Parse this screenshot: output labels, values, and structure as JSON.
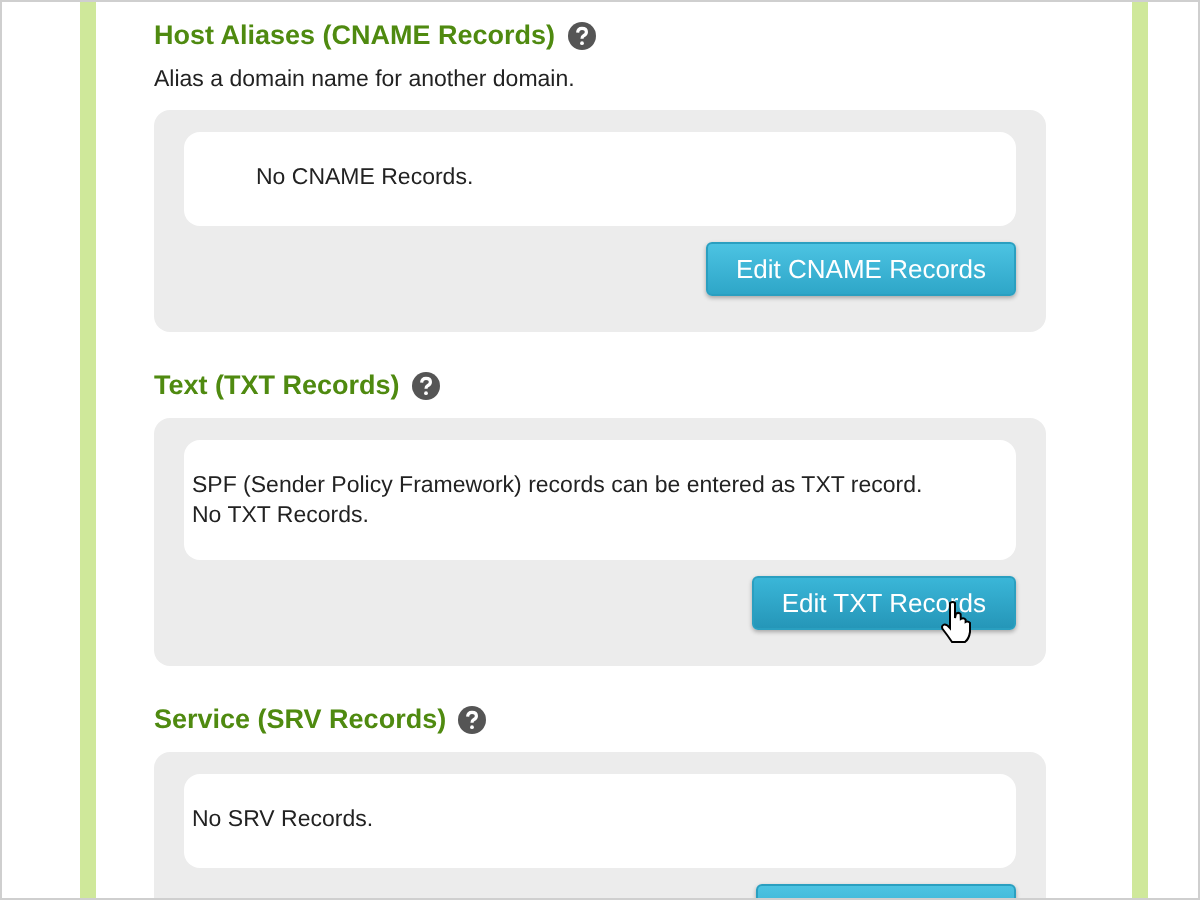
{
  "sections": [
    {
      "title": "Host Aliases (CNAME Records)",
      "description": "Alias a domain name for another domain.",
      "lines": [
        "No CNAME Records."
      ],
      "indent": true,
      "button": {
        "label": "Edit CNAME Records",
        "hovered": false
      }
    },
    {
      "title": "Text (TXT Records)",
      "lines": [
        "SPF (Sender Policy Framework) records can be entered as TXT record.",
        "No TXT Records."
      ],
      "indent": false,
      "button": {
        "label": "Edit TXT Records",
        "hovered": true
      }
    },
    {
      "title": "Service (SRV Records)",
      "lines": [
        "No SRV Records."
      ],
      "indent": false,
      "button": {
        "hovered": false
      }
    }
  ]
}
